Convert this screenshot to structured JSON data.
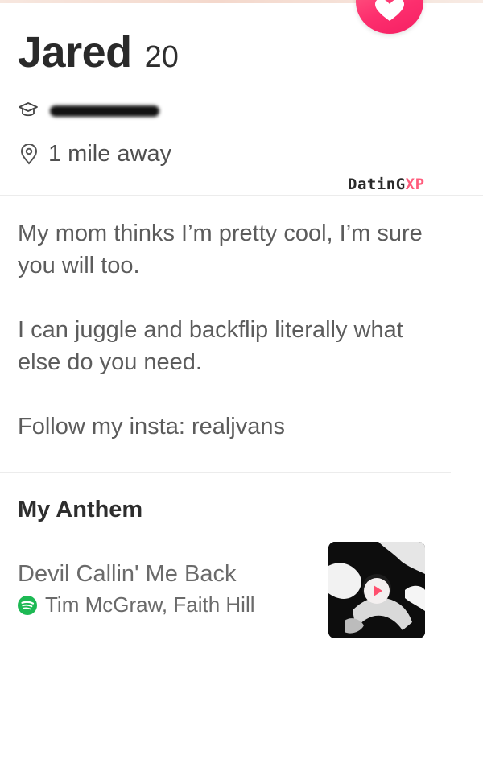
{
  "profile": {
    "name": "Jared",
    "age": "20",
    "distance": "1 mile away"
  },
  "watermark": {
    "brand_main": "DatinG",
    "brand_accent": "XP"
  },
  "bio": {
    "paragraphs": [
      "My mom thinks I’m pretty cool, I’m sure you will too.",
      "I can juggle and backflip literally what else do you need.",
      "Follow my insta: realjvans"
    ]
  },
  "anthem": {
    "heading": "My Anthem",
    "song_title": "Devil Callin' Me Back",
    "artists": "Tim McGraw, Faith Hill"
  },
  "icons": {
    "school": "graduation-cap-icon",
    "location": "location-pin-icon",
    "spotify": "spotify-icon",
    "play": "play-icon",
    "like": "heart-icon"
  },
  "colors": {
    "like_button": "#fd2f6e",
    "spotify_green": "#1db954",
    "watermark_accent": "#ff5c7c"
  }
}
